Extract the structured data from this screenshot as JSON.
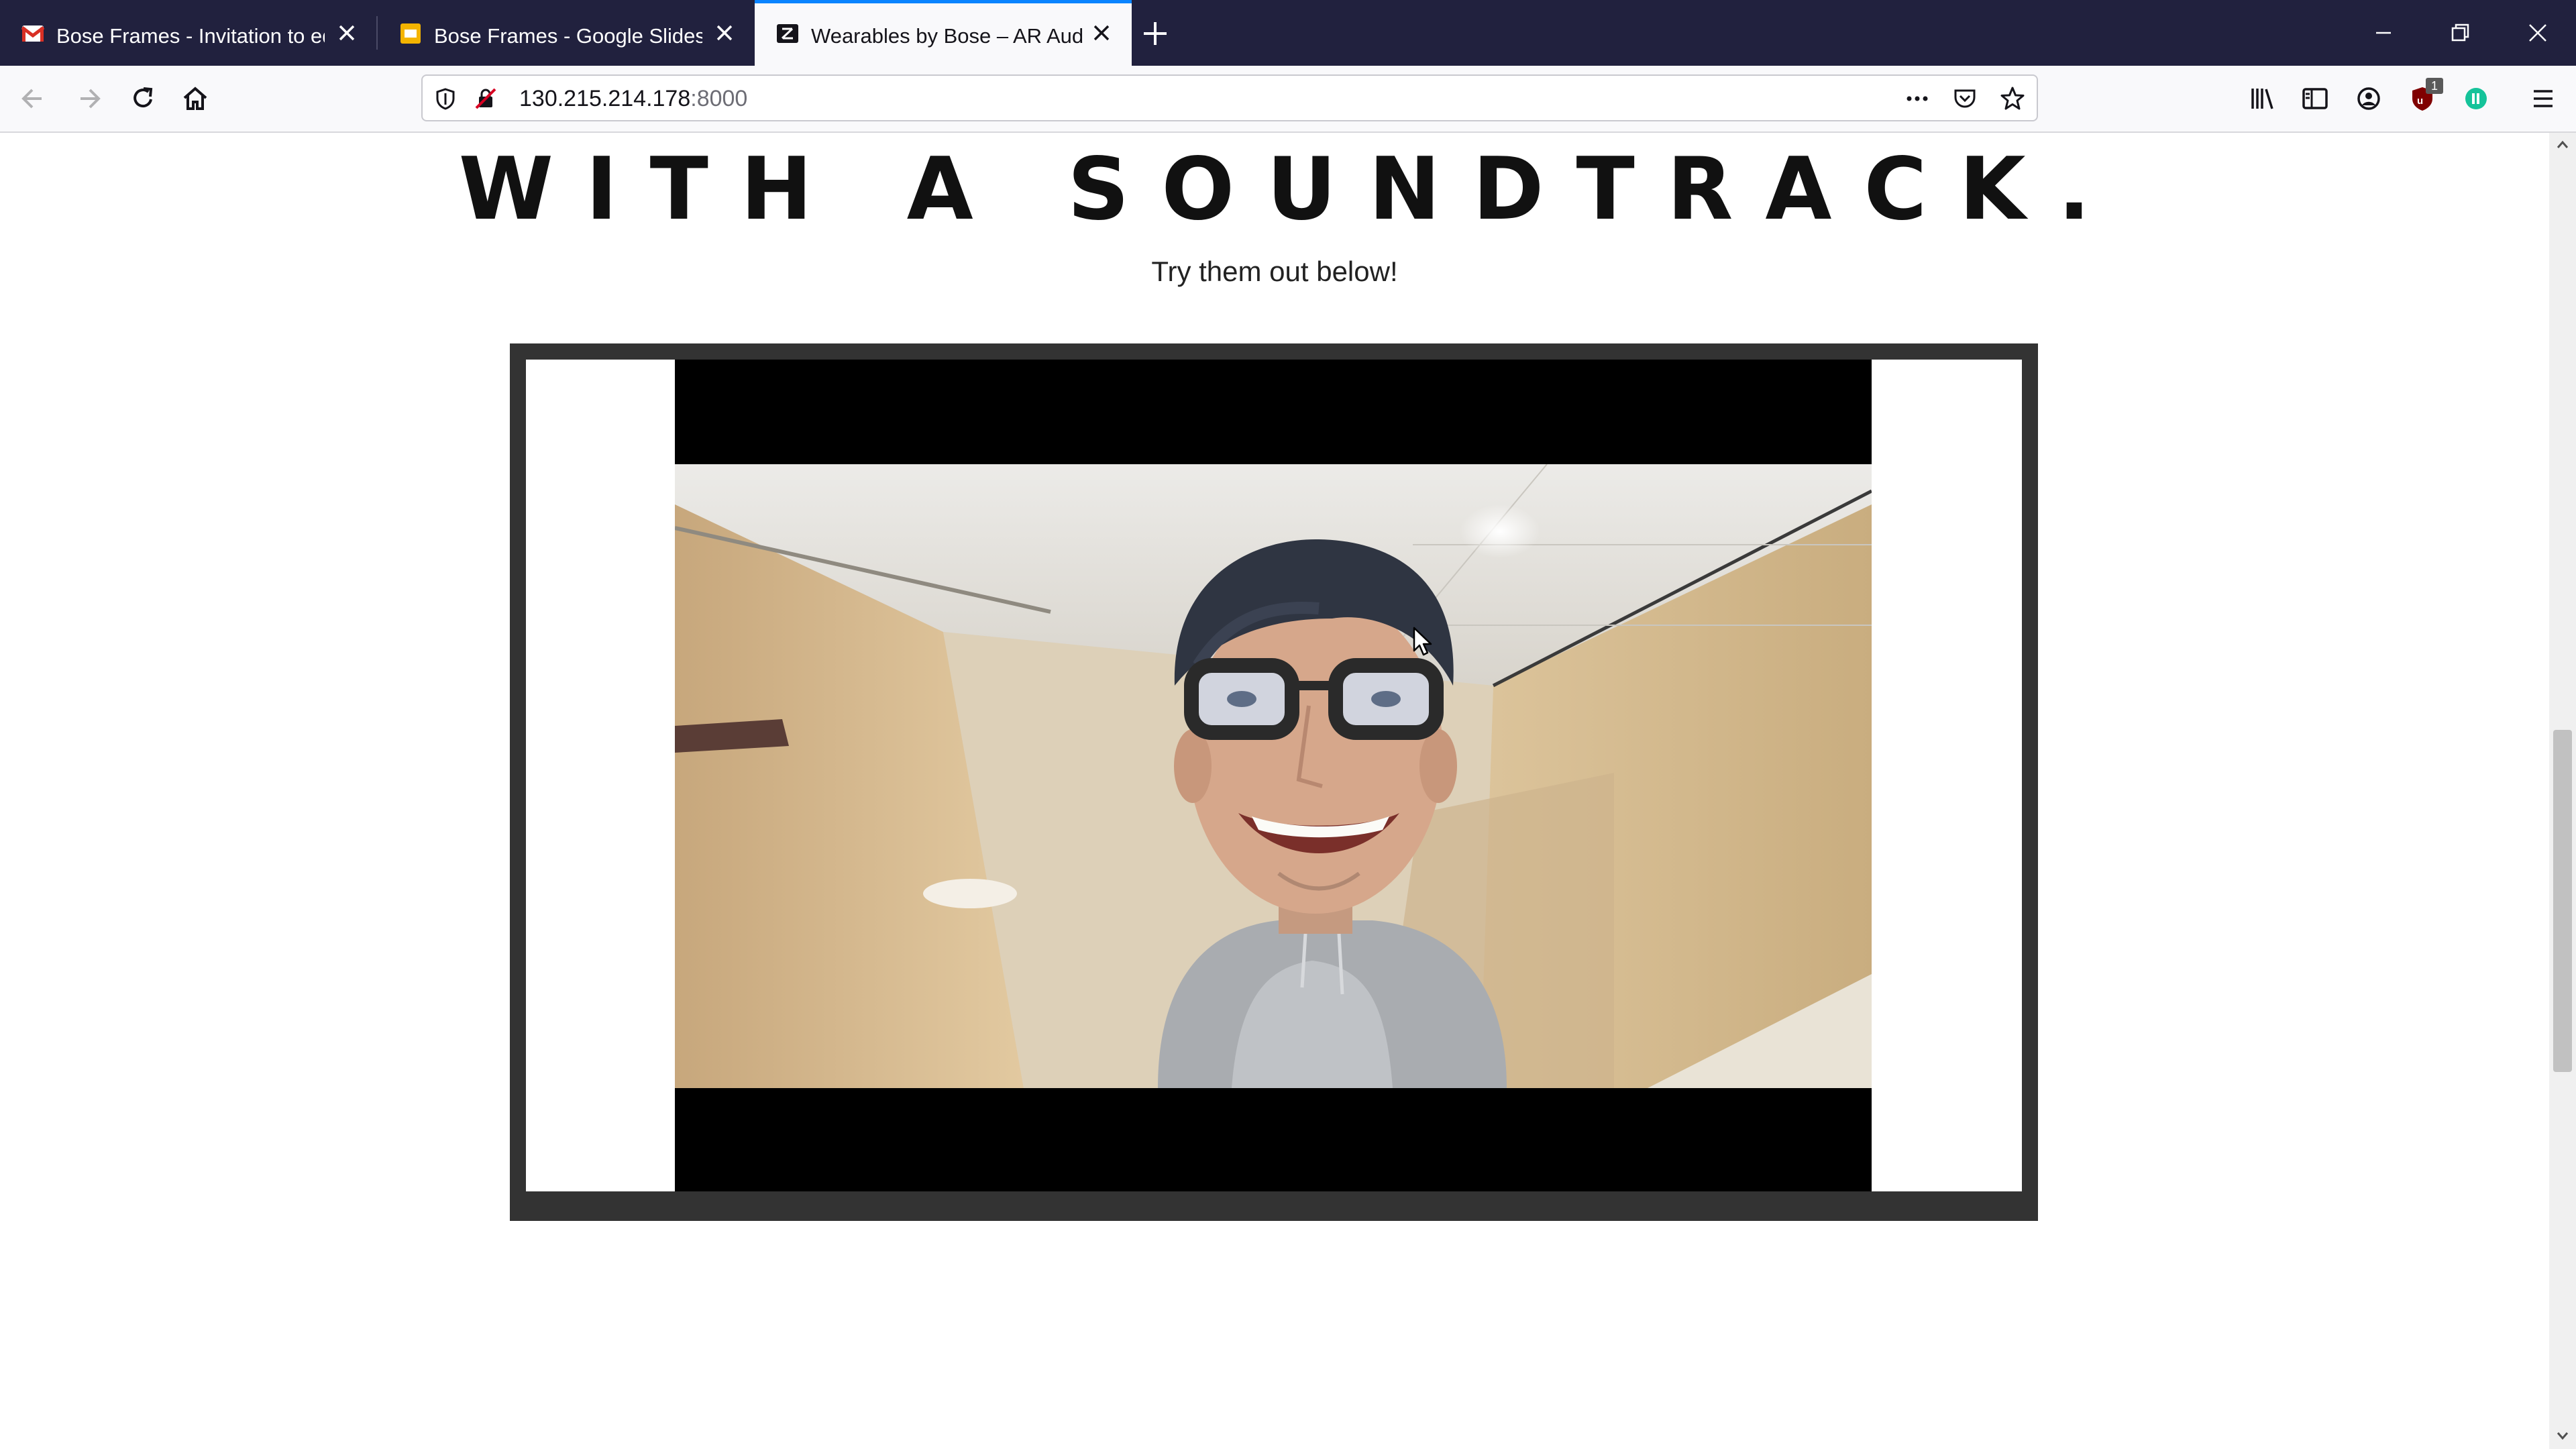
{
  "browser": {
    "tabs": [
      {
        "title": "Bose Frames - Invitation to edit",
        "icon": "gmail-icon",
        "active": false
      },
      {
        "title": "Bose Frames - Google Slides",
        "icon": "google-slides-icon",
        "active": false
      },
      {
        "title": "Wearables by Bose – AR Audio",
        "icon": "bose-icon",
        "active": true
      }
    ],
    "url": {
      "host": "130.215.214.178",
      "port": ":8000"
    },
    "extension_badge": "1"
  },
  "page": {
    "heading": "WITH A SOUNDTRACK.",
    "subtext": "Try them out below!"
  },
  "colors": {
    "tabbar": "#21213e",
    "accent": "#0a84ff",
    "frame": "#333333"
  }
}
